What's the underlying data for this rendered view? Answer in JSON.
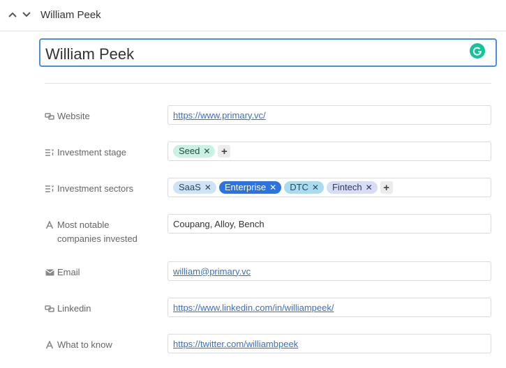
{
  "header": {
    "title": "William Peek",
    "nav_up_icon": "chevron-up-icon",
    "nav_down_icon": "chevron-down-icon"
  },
  "record": {
    "name": "William Peek",
    "grammarly_icon": "grammarly-icon"
  },
  "colors": {
    "accent": "#4a8fdf",
    "link": "#3b6fc4",
    "grammarly": "#15c39a"
  },
  "fields": {
    "website": {
      "label": "Website",
      "icon": "link-icon",
      "value": "https://www.primary.vc/"
    },
    "investment_stage": {
      "label": "Investment stage",
      "icon": "multi-select-icon",
      "tags": [
        {
          "label": "Seed",
          "color": "#c9f1e4"
        }
      ]
    },
    "investment_sectors": {
      "label": "Investment sectors",
      "icon": "multi-select-icon",
      "tags": [
        {
          "label": "SaaS",
          "color": "#cfe3f6"
        },
        {
          "label": "Enterprise",
          "color": "#2a73e0"
        },
        {
          "label": "DTC",
          "color": "#a9dcef"
        },
        {
          "label": "Fintech",
          "color": "#d8dcf4"
        }
      ]
    },
    "notable_companies": {
      "label": "Most notable companies invested",
      "label_line1": "Most notable",
      "label_line2": "companies invested",
      "icon": "text-icon",
      "value": "Coupang, Alloy, Bench"
    },
    "email": {
      "label": "Email",
      "icon": "email-icon",
      "value": "william@primary.vc"
    },
    "linkedin": {
      "label": "Linkedin",
      "icon": "link-icon",
      "value": "https://www.linkedin.com/in/williampeek/"
    },
    "what_to_know": {
      "label": "What to know",
      "icon": "text-icon",
      "value": "https://twitter.com/williambpeek"
    }
  }
}
